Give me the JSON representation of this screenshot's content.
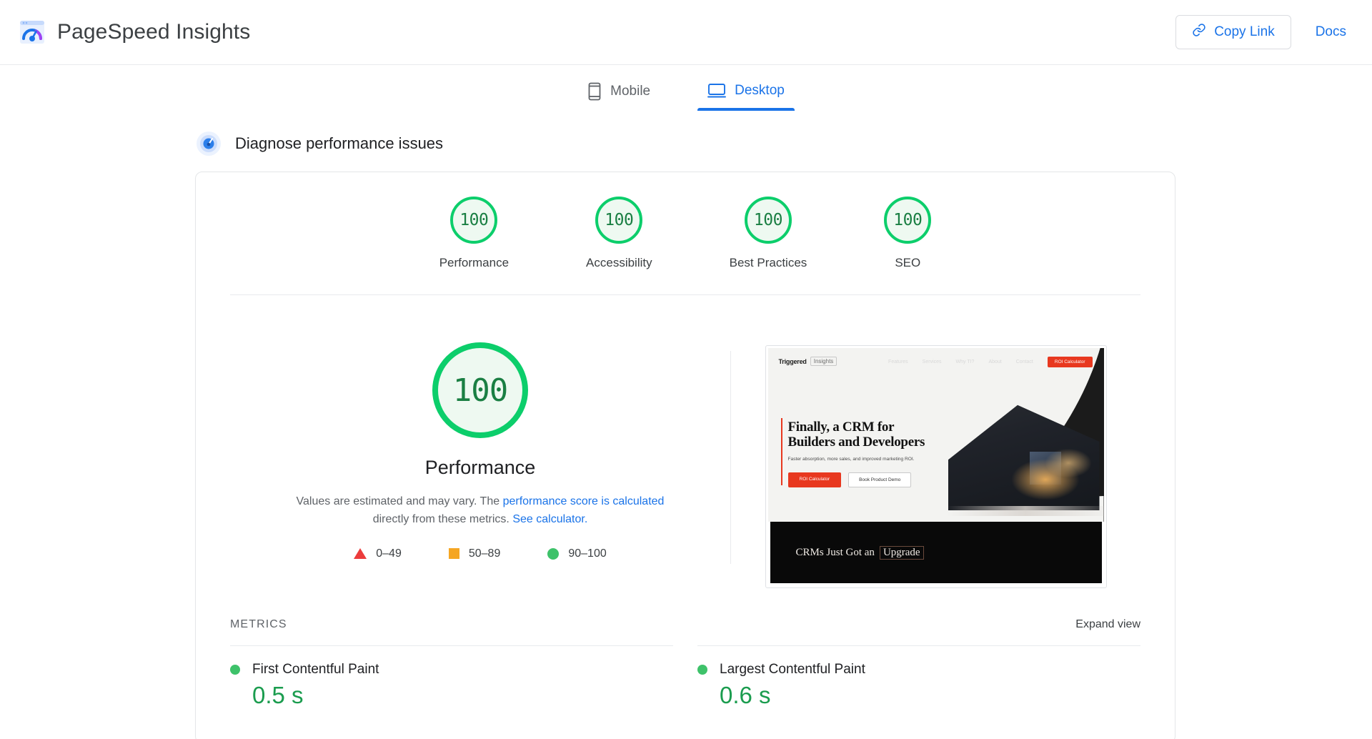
{
  "header": {
    "brand_title": "PageSpeed Insights",
    "logo_icon": "pagespeed-logo-icon",
    "copy_link_label": "Copy Link",
    "copy_link_icon": "link-icon",
    "docs_label": "Docs",
    "accent_color": "#1a73e8"
  },
  "tabs": [
    {
      "label": "Mobile",
      "icon": "mobile-phone-icon",
      "active": false
    },
    {
      "label": "Desktop",
      "icon": "desktop-monitor-icon",
      "active": true
    }
  ],
  "diagnose": {
    "title": "Diagnose performance issues",
    "icon": "gauge-glow-icon"
  },
  "scores": [
    {
      "value": "100",
      "label": "Performance"
    },
    {
      "value": "100",
      "label": "Accessibility"
    },
    {
      "value": "100",
      "label": "Best Practices"
    },
    {
      "value": "100",
      "label": "SEO"
    }
  ],
  "performance": {
    "score": "100",
    "name": "Performance",
    "desc_part1": "Values are estimated and may vary. The ",
    "desc_link1": "performance score is calculated",
    "desc_part2": " directly from these metrics. ",
    "desc_link2": "See calculator.",
    "legend": [
      {
        "shape": "triangle",
        "color": "#ec3c3c",
        "range": "0–49"
      },
      {
        "shape": "square",
        "color": "#f5a623",
        "range": "50–89"
      },
      {
        "shape": "circle",
        "color": "#3ec26a",
        "range": "90–100"
      }
    ]
  },
  "thumbnail": {
    "logo_primary": "Triggered",
    "logo_secondary": "Insights",
    "nav": [
      "Features",
      "Services",
      "Why TI?",
      "About",
      "Contact"
    ],
    "nav_cta": "ROI Calculator",
    "headline_line1": "Finally, a CRM for",
    "headline_line2": "Builders and Developers",
    "subhead": "Faster absorption, more sales, and improved marketing ROI.",
    "btn_primary": "ROI Calculator",
    "btn_secondary": "Book Product Demo",
    "band_text": "CRMs Just Got an",
    "band_boxed": "Upgrade"
  },
  "metrics": {
    "section_title": "METRICS",
    "expand_label": "Expand view",
    "left": [
      {
        "name": "First Contentful Paint",
        "value": "0.5 s",
        "status": "good"
      }
    ],
    "right": [
      {
        "name": "Largest Contentful Paint",
        "value": "0.6 s",
        "status": "good"
      }
    ]
  },
  "colors": {
    "good_green": "#0cce6b",
    "good_text": "#1a7f43",
    "average_orange": "#f5a623",
    "poor_red": "#ec3c3c"
  }
}
